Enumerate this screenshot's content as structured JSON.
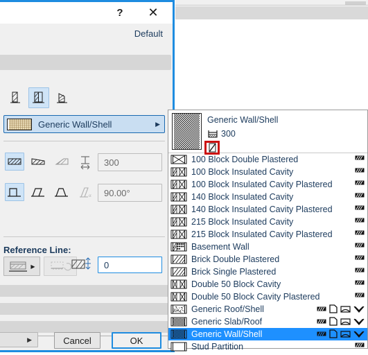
{
  "dialog": {
    "titlebar": {
      "help_label": "?",
      "close_label": "✕"
    },
    "default_label": "Default",
    "geometry_icons": [
      {
        "name": "straight-wall",
        "selected": false
      },
      {
        "name": "curved-wall",
        "selected": true
      },
      {
        "name": "polygon-wall",
        "selected": false
      }
    ],
    "structure_combo": {
      "value": "Generic Wall/Shell",
      "arrow": "▶"
    },
    "profile_icons": [
      {
        "name": "basic-profile",
        "selected": true
      },
      {
        "name": "complex-profile",
        "selected": false
      },
      {
        "name": "slanted-profile",
        "selected": false
      }
    ],
    "edge_icons": [
      {
        "name": "vertical-edge",
        "selected": true
      },
      {
        "name": "slanted-edge",
        "selected": false
      },
      {
        "name": "double-slanted-edge",
        "selected": false
      }
    ],
    "thickness": {
      "value": "300"
    },
    "angle": {
      "value": "90.00°"
    },
    "reference_line": {
      "label": "Reference Line:",
      "offset_value": "0"
    },
    "footer": {
      "more_label": "▶",
      "cancel_label": "Cancel",
      "ok_label": "OK"
    }
  },
  "popup": {
    "preview": {
      "name": "Generic Wall/Shell",
      "thickness": "300"
    },
    "items": [
      {
        "label": "100 Block Double Plastered",
        "icon": "composite-x",
        "tags": [
          "wall"
        ]
      },
      {
        "label": "100 Block Insulated Cavity",
        "icon": "composite-cavity",
        "tags": [
          "wall"
        ]
      },
      {
        "label": "100 Block Insulated Cavity Plastered",
        "icon": "composite-cavity",
        "tags": [
          "wall"
        ]
      },
      {
        "label": "140 Block Insulated Cavity",
        "icon": "composite-cavity",
        "tags": [
          "wall"
        ]
      },
      {
        "label": "140 Block Insulated Cavity Plastered",
        "icon": "composite-cavity",
        "tags": [
          "wall"
        ]
      },
      {
        "label": "215 Block Insulated Cavity",
        "icon": "composite-cavity",
        "tags": [
          "wall"
        ]
      },
      {
        "label": "215 Block Insulated Cavity Plastered",
        "icon": "composite-cavity",
        "tags": [
          "wall"
        ]
      },
      {
        "label": "Basement Wall",
        "icon": "composite-dots",
        "tags": [
          "wall"
        ]
      },
      {
        "label": "Brick Double Plastered",
        "icon": "hatch-diagonal",
        "tags": [
          "wall"
        ]
      },
      {
        "label": "Brick Single Plastered",
        "icon": "hatch-diagonal",
        "tags": [
          "wall"
        ]
      },
      {
        "label": "Double 50 Block Cavity",
        "icon": "composite-double",
        "tags": [
          "wall"
        ]
      },
      {
        "label": "Double 50 Block Cavity Plastered",
        "icon": "composite-double",
        "tags": [
          "wall"
        ]
      },
      {
        "label": "Generic Roof/Shell",
        "icon": "generic-speckle",
        "tags": [
          "wall",
          "page",
          "shell",
          "roof"
        ]
      },
      {
        "label": "Generic Slab/Roof",
        "icon": "generic-checker",
        "tags": [
          "wall",
          "page",
          "shell",
          "roof"
        ]
      },
      {
        "label": "Generic Wall/Shell",
        "icon": "generic-checker",
        "tags": [
          "wall",
          "page",
          "shell",
          "roof"
        ],
        "selected": true
      },
      {
        "label": "Stud Partition",
        "icon": "empty-box",
        "tags": [
          "wall"
        ]
      }
    ]
  },
  "colors": {
    "accent": "#1e8ce0",
    "selection": "#1e90ff",
    "highlight_box": "#cc1111",
    "text": "#1b3a5c",
    "panel_bg": "#f0f0f0",
    "band_bg": "#d6d6d6"
  }
}
